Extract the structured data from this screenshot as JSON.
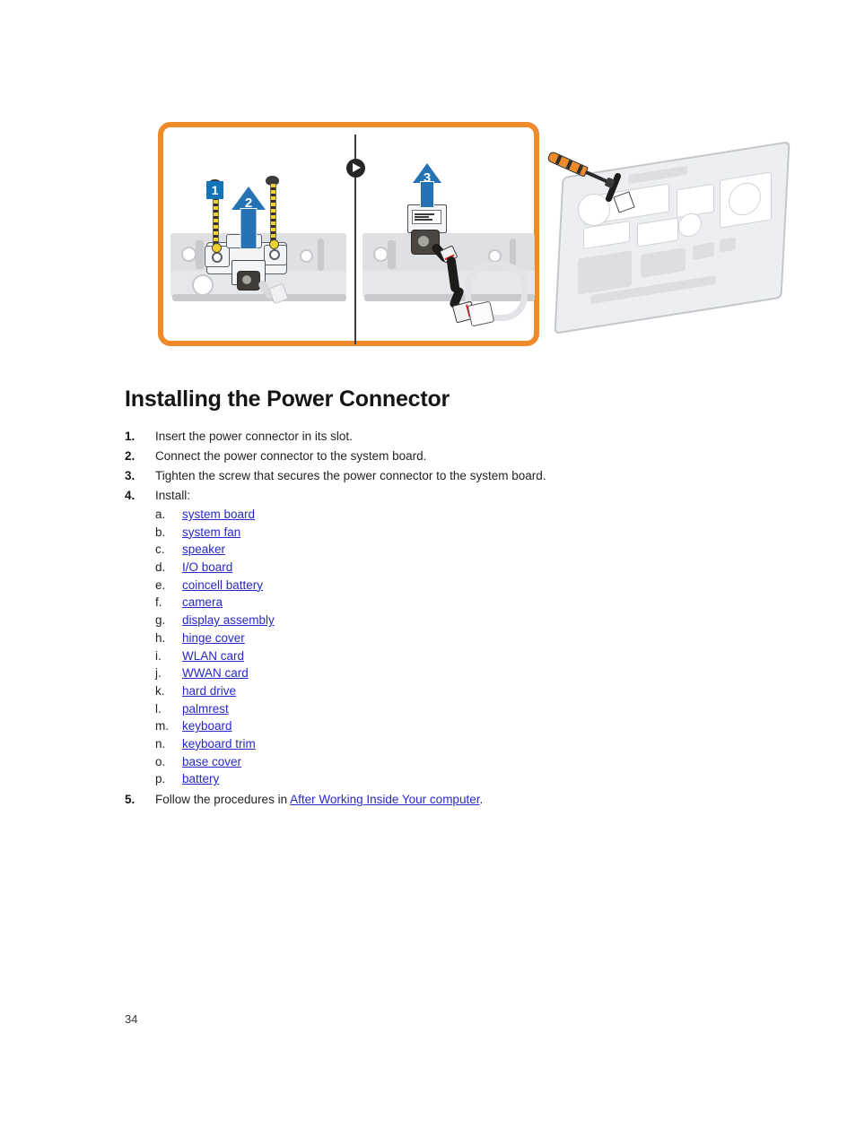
{
  "document": {
    "page_number": "34",
    "heading": "Installing the Power Connector"
  },
  "figure": {
    "callouts": [
      "1",
      "2",
      "3"
    ],
    "divider_icon": "play-icon",
    "frame_color": "#ef8a2b",
    "callout_color": "#1173b8",
    "arrow_color": "#2573b5"
  },
  "steps": [
    {
      "num": "1.",
      "text": "Insert the power connector in its slot."
    },
    {
      "num": "2.",
      "text": "Connect the power connector to the system board."
    },
    {
      "num": "3.",
      "text": "Tighten the screw that secures the power connector to the system board."
    },
    {
      "num": "4.",
      "text": "Install:"
    }
  ],
  "install_list": [
    {
      "alpha": "a.",
      "label": "system board"
    },
    {
      "alpha": "b.",
      "label": "system fan"
    },
    {
      "alpha": "c.",
      "label": "speaker"
    },
    {
      "alpha": "d.",
      "label": "I/O board"
    },
    {
      "alpha": "e.",
      "label": "coincell battery"
    },
    {
      "alpha": "f.",
      "label": "camera"
    },
    {
      "alpha": "g.",
      "label": "display assembly"
    },
    {
      "alpha": "h.",
      "label": "hinge cover"
    },
    {
      "alpha": "i.",
      "label": "WLAN card"
    },
    {
      "alpha": "j.",
      "label": "WWAN card"
    },
    {
      "alpha": "k.",
      "label": "hard drive"
    },
    {
      "alpha": "l.",
      "label": "palmrest"
    },
    {
      "alpha": "m.",
      "label": "keyboard"
    },
    {
      "alpha": "n.",
      "label": "keyboard trim"
    },
    {
      "alpha": "o.",
      "label": "base cover"
    },
    {
      "alpha": "p.",
      "label": "battery"
    }
  ],
  "final_step": {
    "num": "5.",
    "text_before": "Follow the procedures in ",
    "link": "After Working Inside Your computer",
    "text_after": "."
  }
}
